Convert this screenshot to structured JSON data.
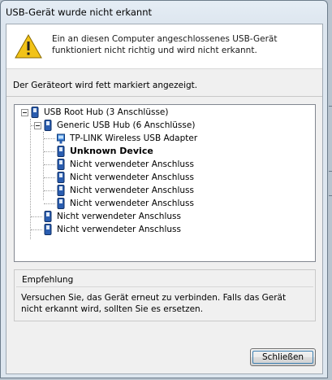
{
  "window": {
    "title": "USB-Gerät wurde nicht erkannt"
  },
  "message": {
    "text": "Ein an diesen Computer angeschlossenes USB-Gerät funktioniert nicht richtig und wird nicht erkannt.",
    "icon": "warning-icon"
  },
  "hint": "Der Geräteort wird fett markiert angezeigt.",
  "tree": {
    "nodes": [
      {
        "label": "USB Root Hub (3 Anschlüsse)",
        "icon": "usb-hub-icon",
        "expanded": true,
        "bold": false
      },
      {
        "label": "Generic USB Hub (6 Anschlüsse)",
        "icon": "usb-hub-icon",
        "expanded": true,
        "bold": false
      },
      {
        "label": "TP-LINK Wireless USB Adapter",
        "icon": "network-adapter-icon",
        "bold": false
      },
      {
        "label": "Unknown Device",
        "icon": "usb-port-icon",
        "bold": true
      },
      {
        "label": "Nicht verwendeter Anschluss",
        "icon": "usb-port-icon",
        "bold": false
      },
      {
        "label": "Nicht verwendeter Anschluss",
        "icon": "usb-port-icon",
        "bold": false
      },
      {
        "label": "Nicht verwendeter Anschluss",
        "icon": "usb-port-icon",
        "bold": false
      },
      {
        "label": "Nicht verwendeter Anschluss",
        "icon": "usb-port-icon",
        "bold": false
      },
      {
        "label": "Nicht verwendeter Anschluss",
        "icon": "usb-port-icon",
        "bold": false
      },
      {
        "label": "Nicht verwendeter Anschluss",
        "icon": "usb-port-icon",
        "bold": false
      }
    ]
  },
  "recommendation": {
    "title": "Empfehlung",
    "text": "Versuchen Sie, das Gerät erneut zu verbinden. Falls das Gerät nicht erkannt wird, sollten Sie es ersetzen."
  },
  "buttons": {
    "close": "Schließen"
  },
  "colors": {
    "warning_yellow": "#f2c318",
    "device_blue": "#2a5db0"
  }
}
